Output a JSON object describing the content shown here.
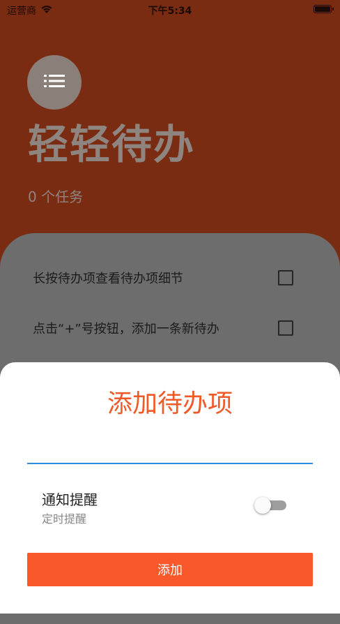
{
  "status_bar": {
    "carrier": "运营商",
    "time": "下午5:34"
  },
  "header": {
    "menu_icon": "list-icon",
    "title": "轻轻待办",
    "task_count": "0 个任务"
  },
  "todos": [
    {
      "text": "长按待办项查看待办项细节",
      "checked": false
    },
    {
      "text": "点击“+”号按钮，添加一条新待办",
      "checked": false
    }
  ],
  "sheet": {
    "title": "添加待办项",
    "input_value": "",
    "notify_label": "通知提醒",
    "notify_sub": "定时提醒",
    "notify_enabled": false,
    "add_label": "添加"
  },
  "colors": {
    "background": "#7a2c12",
    "accent": "#f9582a",
    "title_accent": "#f05a28",
    "input_underline": "#2f8de4"
  }
}
